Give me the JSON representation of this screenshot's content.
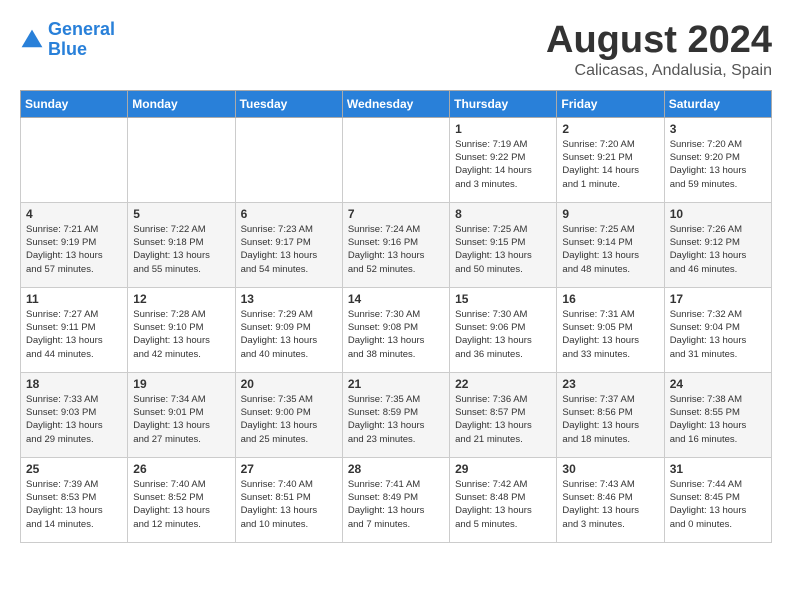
{
  "header": {
    "logo_line1": "General",
    "logo_line2": "Blue",
    "month": "August 2024",
    "location": "Calicasas, Andalusia, Spain"
  },
  "days_of_week": [
    "Sunday",
    "Monday",
    "Tuesday",
    "Wednesday",
    "Thursday",
    "Friday",
    "Saturday"
  ],
  "weeks": [
    [
      {
        "day": "",
        "info": ""
      },
      {
        "day": "",
        "info": ""
      },
      {
        "day": "",
        "info": ""
      },
      {
        "day": "",
        "info": ""
      },
      {
        "day": "1",
        "info": "Sunrise: 7:19 AM\nSunset: 9:22 PM\nDaylight: 14 hours\nand 3 minutes."
      },
      {
        "day": "2",
        "info": "Sunrise: 7:20 AM\nSunset: 9:21 PM\nDaylight: 14 hours\nand 1 minute."
      },
      {
        "day": "3",
        "info": "Sunrise: 7:20 AM\nSunset: 9:20 PM\nDaylight: 13 hours\nand 59 minutes."
      }
    ],
    [
      {
        "day": "4",
        "info": "Sunrise: 7:21 AM\nSunset: 9:19 PM\nDaylight: 13 hours\nand 57 minutes."
      },
      {
        "day": "5",
        "info": "Sunrise: 7:22 AM\nSunset: 9:18 PM\nDaylight: 13 hours\nand 55 minutes."
      },
      {
        "day": "6",
        "info": "Sunrise: 7:23 AM\nSunset: 9:17 PM\nDaylight: 13 hours\nand 54 minutes."
      },
      {
        "day": "7",
        "info": "Sunrise: 7:24 AM\nSunset: 9:16 PM\nDaylight: 13 hours\nand 52 minutes."
      },
      {
        "day": "8",
        "info": "Sunrise: 7:25 AM\nSunset: 9:15 PM\nDaylight: 13 hours\nand 50 minutes."
      },
      {
        "day": "9",
        "info": "Sunrise: 7:25 AM\nSunset: 9:14 PM\nDaylight: 13 hours\nand 48 minutes."
      },
      {
        "day": "10",
        "info": "Sunrise: 7:26 AM\nSunset: 9:12 PM\nDaylight: 13 hours\nand 46 minutes."
      }
    ],
    [
      {
        "day": "11",
        "info": "Sunrise: 7:27 AM\nSunset: 9:11 PM\nDaylight: 13 hours\nand 44 minutes."
      },
      {
        "day": "12",
        "info": "Sunrise: 7:28 AM\nSunset: 9:10 PM\nDaylight: 13 hours\nand 42 minutes."
      },
      {
        "day": "13",
        "info": "Sunrise: 7:29 AM\nSunset: 9:09 PM\nDaylight: 13 hours\nand 40 minutes."
      },
      {
        "day": "14",
        "info": "Sunrise: 7:30 AM\nSunset: 9:08 PM\nDaylight: 13 hours\nand 38 minutes."
      },
      {
        "day": "15",
        "info": "Sunrise: 7:30 AM\nSunset: 9:06 PM\nDaylight: 13 hours\nand 36 minutes."
      },
      {
        "day": "16",
        "info": "Sunrise: 7:31 AM\nSunset: 9:05 PM\nDaylight: 13 hours\nand 33 minutes."
      },
      {
        "day": "17",
        "info": "Sunrise: 7:32 AM\nSunset: 9:04 PM\nDaylight: 13 hours\nand 31 minutes."
      }
    ],
    [
      {
        "day": "18",
        "info": "Sunrise: 7:33 AM\nSunset: 9:03 PM\nDaylight: 13 hours\nand 29 minutes."
      },
      {
        "day": "19",
        "info": "Sunrise: 7:34 AM\nSunset: 9:01 PM\nDaylight: 13 hours\nand 27 minutes."
      },
      {
        "day": "20",
        "info": "Sunrise: 7:35 AM\nSunset: 9:00 PM\nDaylight: 13 hours\nand 25 minutes."
      },
      {
        "day": "21",
        "info": "Sunrise: 7:35 AM\nSunset: 8:59 PM\nDaylight: 13 hours\nand 23 minutes."
      },
      {
        "day": "22",
        "info": "Sunrise: 7:36 AM\nSunset: 8:57 PM\nDaylight: 13 hours\nand 21 minutes."
      },
      {
        "day": "23",
        "info": "Sunrise: 7:37 AM\nSunset: 8:56 PM\nDaylight: 13 hours\nand 18 minutes."
      },
      {
        "day": "24",
        "info": "Sunrise: 7:38 AM\nSunset: 8:55 PM\nDaylight: 13 hours\nand 16 minutes."
      }
    ],
    [
      {
        "day": "25",
        "info": "Sunrise: 7:39 AM\nSunset: 8:53 PM\nDaylight: 13 hours\nand 14 minutes."
      },
      {
        "day": "26",
        "info": "Sunrise: 7:40 AM\nSunset: 8:52 PM\nDaylight: 13 hours\nand 12 minutes."
      },
      {
        "day": "27",
        "info": "Sunrise: 7:40 AM\nSunset: 8:51 PM\nDaylight: 13 hours\nand 10 minutes."
      },
      {
        "day": "28",
        "info": "Sunrise: 7:41 AM\nSunset: 8:49 PM\nDaylight: 13 hours\nand 7 minutes."
      },
      {
        "day": "29",
        "info": "Sunrise: 7:42 AM\nSunset: 8:48 PM\nDaylight: 13 hours\nand 5 minutes."
      },
      {
        "day": "30",
        "info": "Sunrise: 7:43 AM\nSunset: 8:46 PM\nDaylight: 13 hours\nand 3 minutes."
      },
      {
        "day": "31",
        "info": "Sunrise: 7:44 AM\nSunset: 8:45 PM\nDaylight: 13 hours\nand 0 minutes."
      }
    ]
  ]
}
